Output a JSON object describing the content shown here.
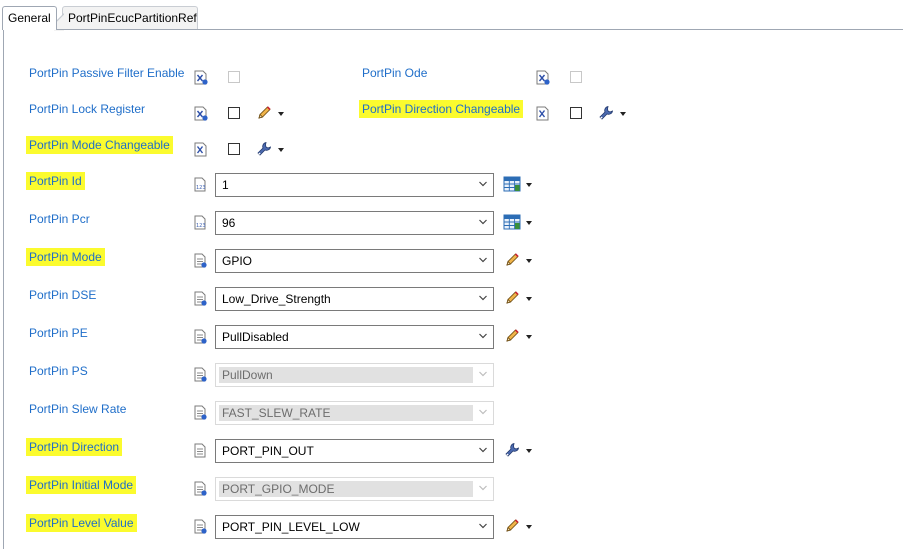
{
  "tabs": [
    {
      "label": "General",
      "active": true
    },
    {
      "label": "PortPinEcucPartitionRef",
      "active": false
    }
  ],
  "highlight_color": "#fbfb2e",
  "label_color": "#1f6ec9",
  "rows": {
    "passive_filter": {
      "label": "PortPin Passive Filter Enable",
      "checked": false,
      "enabled": false
    },
    "ode": {
      "label": "PortPin Ode",
      "checked": false,
      "enabled": false
    },
    "lock_register": {
      "label": "PortPin Lock Register",
      "checked": false,
      "enabled": true,
      "action_icon": "pencil-icon"
    },
    "direction_changeable": {
      "label": "PortPin Direction Changeable",
      "checked": false,
      "enabled": true,
      "action_icon": "wrench-icon",
      "highlighted": true
    },
    "mode_changeable": {
      "label": "PortPin Mode Changeable",
      "checked": false,
      "enabled": true,
      "action_icon": "wrench-icon",
      "highlighted": true
    },
    "id": {
      "label": "PortPin Id",
      "value": "1",
      "enabled": true,
      "action_icon": "calculator-icon",
      "highlighted": true
    },
    "pcr": {
      "label": "PortPin Pcr",
      "value": "96",
      "enabled": true,
      "action_icon": "calculator-icon"
    },
    "mode": {
      "label": "PortPin Mode",
      "value": "GPIO",
      "enabled": true,
      "action_icon": "pencil-icon",
      "highlighted": true
    },
    "dse": {
      "label": "PortPin DSE",
      "value": "Low_Drive_Strength",
      "enabled": true,
      "action_icon": "pencil-icon"
    },
    "pe": {
      "label": "PortPin PE",
      "value": "PullDisabled",
      "enabled": true,
      "action_icon": "pencil-icon"
    },
    "ps": {
      "label": "PortPin PS",
      "value": "PullDown",
      "enabled": false
    },
    "slew_rate": {
      "label": "PortPin Slew Rate",
      "value": "FAST_SLEW_RATE",
      "enabled": false
    },
    "direction": {
      "label": "PortPin Direction",
      "value": "PORT_PIN_OUT",
      "enabled": true,
      "action_icon": "wrench-icon",
      "highlighted": true
    },
    "initial_mode": {
      "label": "PortPin Initial Mode",
      "value": "PORT_GPIO_MODE",
      "enabled": false,
      "highlighted": true
    },
    "level_value": {
      "label": "PortPin Level Value",
      "value": "PORT_PIN_LEVEL_LOW",
      "enabled": true,
      "action_icon": "pencil-icon",
      "highlighted": true
    }
  }
}
